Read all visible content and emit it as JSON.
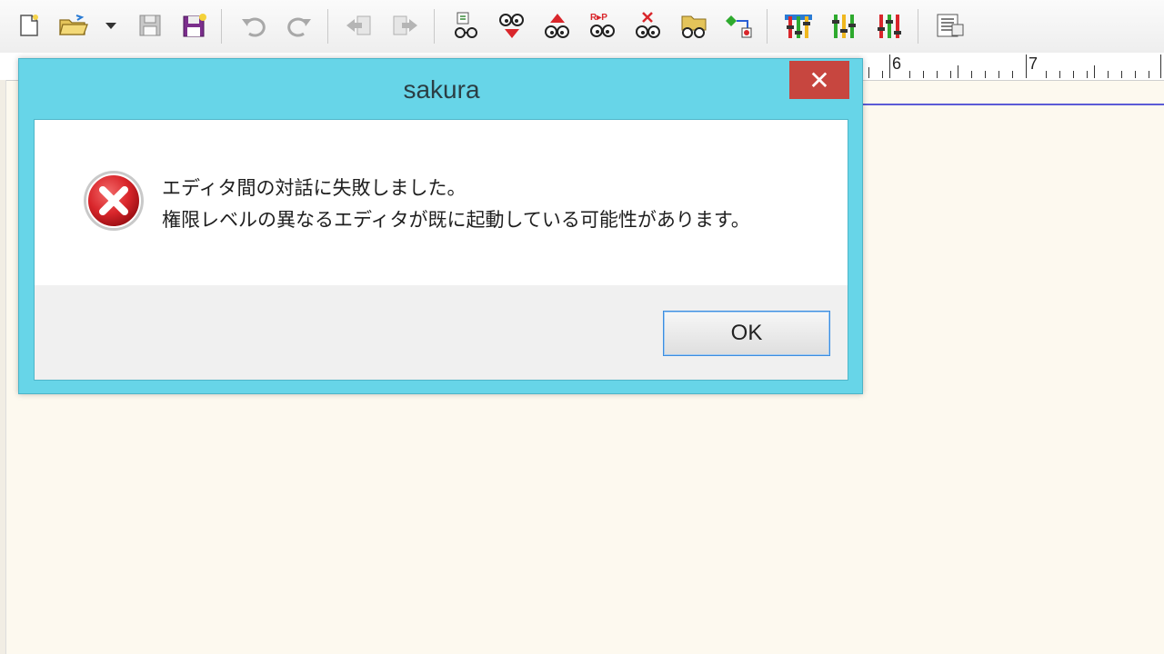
{
  "toolbar": {
    "buttons": [
      {
        "name": "new-file-icon"
      },
      {
        "name": "open-folder-icon"
      },
      {
        "name": "open-dropdown-icon"
      },
      {
        "name": "save-icon"
      },
      {
        "name": "save-all-icon"
      },
      {
        "name": "undo-icon"
      },
      {
        "name": "redo-icon"
      },
      {
        "name": "jump-back-icon"
      },
      {
        "name": "jump-forward-icon"
      },
      {
        "name": "search-icon"
      },
      {
        "name": "search-down-icon"
      },
      {
        "name": "search-up-icon"
      },
      {
        "name": "replace-icon"
      },
      {
        "name": "clear-highlight-icon"
      },
      {
        "name": "grep-icon"
      },
      {
        "name": "tag-jump-icon"
      },
      {
        "name": "settings-common-icon"
      },
      {
        "name": "settings-type-icon"
      },
      {
        "name": "settings-font-icon"
      },
      {
        "name": "window-list-icon"
      }
    ]
  },
  "ruler": {
    "labels": [
      "6",
      "7"
    ]
  },
  "dialog": {
    "title": "sakura",
    "close_label": "✕",
    "message_line1": "エディタ間の対話に失敗しました。",
    "message_line2": "権限レベルの異なるエディタが既に起動している可能性があります。",
    "ok_label": "OK"
  },
  "colors": {
    "dialog_frame": "#67d5e8",
    "close_button": "#c7463f",
    "error_icon": "#d9262b",
    "editor_background": "#fdf9ef"
  }
}
